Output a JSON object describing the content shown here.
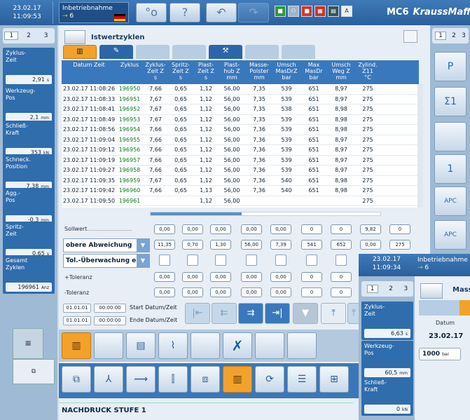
{
  "topbar": {
    "date": "23.02.17",
    "time": "11:09:53",
    "mode_label": "Inbetriebnahme",
    "mode_level": "6",
    "brand_model": "MC6",
    "brand_name": "KraussMaffei",
    "icons": [
      "green-status-icon",
      "user-icon",
      "red-status-icon",
      "machine-icon",
      "network-icon",
      "apc-icon"
    ]
  },
  "left_sidebar": {
    "pages": [
      "1",
      "2",
      "3"
    ],
    "panels": [
      {
        "label": "Zyklus-\nZeit",
        "value": "2,91",
        "unit": "s"
      },
      {
        "label": "Werkzeug-\nPos",
        "value": "2,1",
        "unit": "mm"
      },
      {
        "label": "Schließ-\nKraft",
        "value": "353",
        "unit": "kN"
      },
      {
        "label": "Schneck.\nPosition",
        "value": "7,38",
        "unit": "mm"
      },
      {
        "label": "Agg.-\nPos",
        "value": "-0,3",
        "unit": "mm"
      },
      {
        "label": "Spritz-\nZeit",
        "value": "0,65",
        "unit": "s"
      },
      {
        "label": "Gesamt\nZyklen",
        "value": "196961",
        "unit": "Anz"
      }
    ]
  },
  "main": {
    "title": "Istwertzyklen",
    "table": {
      "columns": [
        "Datum  Zeit",
        "Zyklus",
        "Zyklus-\nZeit Z\ns",
        "Spritz-\nZeit Z\ns",
        "Plast-\nZeit Z\ns",
        "Plast-\nhub Z\nmm",
        "Masse-\nPolster\nmm",
        "Umsch\nMasDrZ\nbar",
        "Max\nMasDr\nbar",
        "Umsch\nWeg Z\nmm",
        "Zylind.\nZ11\n°C"
      ],
      "rows": [
        [
          "23.02.17 11:08:26",
          "196950",
          "7,66",
          "0,65",
          "1,12",
          "56,00",
          "7,35",
          "539",
          "651",
          "8,97",
          "275"
        ],
        [
          "23.02.17 11:08:33",
          "196951",
          "7,67",
          "0,65",
          "1,12",
          "56,00",
          "7,35",
          "539",
          "651",
          "8,97",
          "275"
        ],
        [
          "23.02.17 11:08:41",
          "196952",
          "7,67",
          "0,65",
          "1,12",
          "56,00",
          "7,35",
          "538",
          "651",
          "8,98",
          "275"
        ],
        [
          "23.02.17 11:08:49",
          "196953",
          "7,67",
          "0,65",
          "1,12",
          "56,00",
          "7,35",
          "539",
          "651",
          "8,98",
          "275"
        ],
        [
          "23.02.17 11:08:56",
          "196954",
          "7,66",
          "0,65",
          "1,12",
          "56,00",
          "7,36",
          "539",
          "651",
          "8,98",
          "275"
        ],
        [
          "23.02.17 11:09:04",
          "196955",
          "7,66",
          "0,65",
          "1,12",
          "56,00",
          "7,36",
          "539",
          "651",
          "8,97",
          "275"
        ],
        [
          "23.02.17 11:09:12",
          "196956",
          "7,66",
          "0,65",
          "1,12",
          "56,00",
          "7,36",
          "539",
          "651",
          "8,97",
          "275"
        ],
        [
          "23.02.17 11:09:19",
          "196957",
          "7,66",
          "0,65",
          "1,12",
          "56,00",
          "7,36",
          "539",
          "651",
          "8,97",
          "275"
        ],
        [
          "23.02.17 11:09:27",
          "196958",
          "7,66",
          "0,65",
          "1,12",
          "56,00",
          "7,36",
          "539",
          "651",
          "8,97",
          "275"
        ],
        [
          "23.02.17 11:09:35",
          "196959",
          "7,67",
          "0,65",
          "1,12",
          "56,00",
          "7,36",
          "540",
          "651",
          "8,98",
          "275"
        ],
        [
          "23.02.17 11:09:42",
          "196960",
          "7,66",
          "0,65",
          "1,13",
          "56,00",
          "7,36",
          "540",
          "651",
          "8,98",
          "275"
        ],
        [
          "23.02.17 11:09:50",
          "196961",
          "",
          "",
          "1,12",
          "56,00",
          "",
          "",
          "",
          "",
          "275"
        ]
      ]
    },
    "sollwert": {
      "label": "Sollwert",
      "values": [
        "0,00",
        "0,00",
        "0,00",
        "0,00",
        "0,00",
        "0",
        "0",
        "9,82",
        "0"
      ]
    },
    "obere": {
      "select": "obere Abweichung",
      "values": [
        "11,35",
        "0,70",
        "1,30",
        "56,00",
        "7,39",
        "541",
        "652",
        "0,00",
        "275"
      ]
    },
    "tol": {
      "select": "Tol.-Überwachung ein"
    },
    "plus_tol": {
      "label": "+Toleranz",
      "values": [
        "0,00",
        "0,00",
        "0,00",
        "0,00",
        "0,00",
        "0",
        "0"
      ]
    },
    "minus_tol": {
      "label": "-Toleranz",
      "values": [
        "0,00",
        "0,00",
        "0,00",
        "0,00",
        "0,00",
        "0",
        "0"
      ]
    },
    "start": {
      "date": "01.01.01",
      "time": "00:00:00",
      "label": "Start Datum/Zeit"
    },
    "end": {
      "date": "01.01.01",
      "time": "00:00:00",
      "label": "Ende Datum/Zeit"
    },
    "status": "NACHDRUCK STUFE 1"
  },
  "right_sidebar": {
    "pages": [
      "1",
      "2",
      "3"
    ],
    "buttons": [
      "P",
      "Σ1",
      "",
      "1",
      "APC",
      "APC"
    ]
  },
  "overlay": {
    "date": "23.02.17",
    "time": "11:09:34",
    "mode_label": "Inbetriebnahme",
    "mode_level": "6",
    "pages": [
      "1",
      "2",
      "3"
    ],
    "title": "Mass",
    "col_label": "Datum",
    "col_value": "23.02.17",
    "box_value": "1000",
    "box_unit": "bar",
    "panels": [
      {
        "label": "Zyklus-\nZeit",
        "value": "6,63",
        "unit": "s"
      },
      {
        "label": "Werkzeug-\nPos",
        "value": "60,5",
        "unit": "mm"
      },
      {
        "label": "Schließ-\nKraft",
        "value": "0",
        "unit": "kN"
      }
    ]
  }
}
